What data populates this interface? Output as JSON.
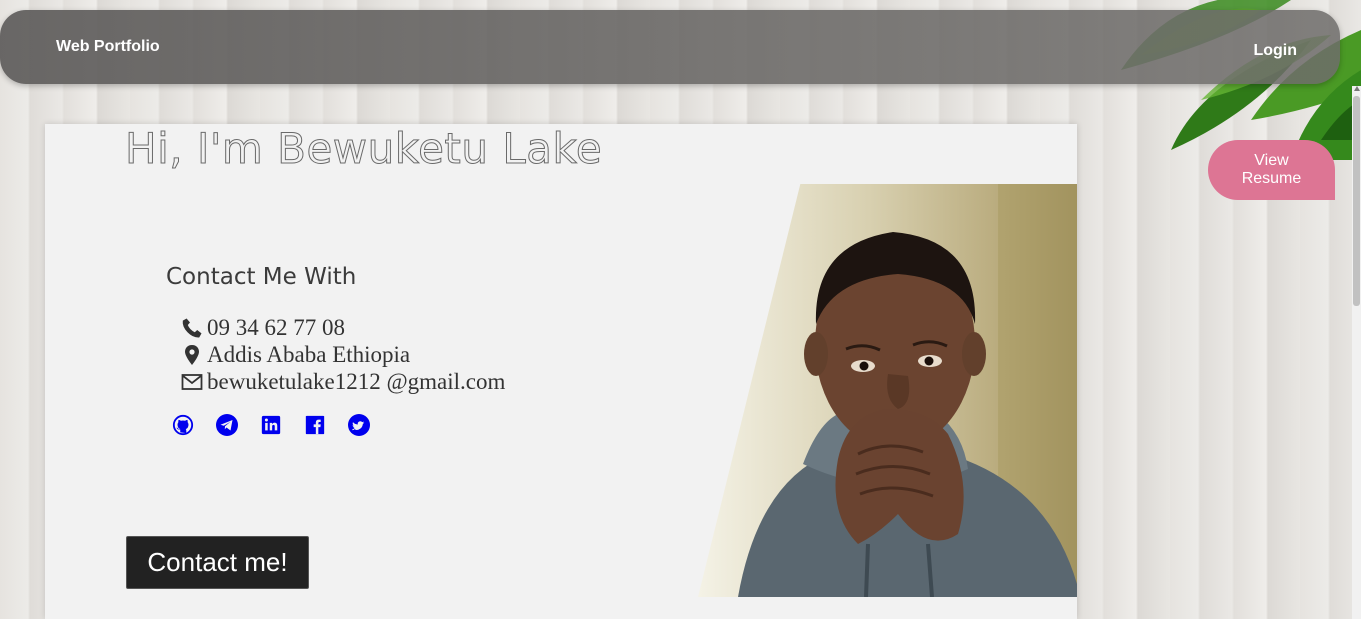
{
  "nav": {
    "brand": "Web Portfolio",
    "login": "Login"
  },
  "resume_button": {
    "line1": "View",
    "line2": "Resume"
  },
  "hero": {
    "title": "Hi, I'm Bewuketu Lake",
    "contact_heading": "Contact Me With",
    "phone": "09 34 62 77 08",
    "location": "Addis Ababa Ethiopia",
    "email": "bewuketulake1212 @gmail.com",
    "contact_button": "Contact me!"
  },
  "socials": [
    "github-icon",
    "telegram-icon",
    "linkedin-icon",
    "facebook-icon",
    "twitter-icon"
  ],
  "colors": {
    "nav_bg": "#5f5d5c",
    "resume_button": "#dd7594",
    "social_icons": "#0000ee",
    "contact_button": "#222222"
  }
}
